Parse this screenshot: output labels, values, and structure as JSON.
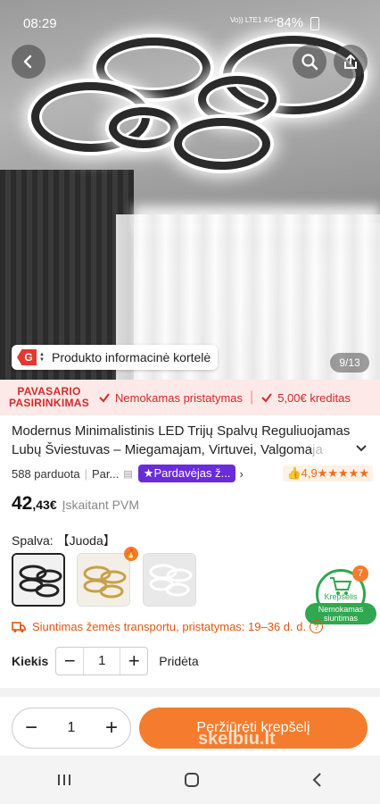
{
  "status_bar": {
    "time": "08:29",
    "network": "Vo))\nLTE1",
    "network_2": "4G+",
    "battery": "84%"
  },
  "gallery": {
    "counter": "9/13",
    "info_badge_letter": "G",
    "info_label": "Produkto informacinė kortelė"
  },
  "promo_bar": {
    "brand_line1": "PAVASARIO",
    "brand_line2": "PASIRINKIMAS",
    "free_shipping": "Nemokamas pristatymas",
    "credit": "5,00€ kreditas"
  },
  "product": {
    "title": "Modernus Minimalistinis LED Trijų Spalvų Reguliuojamas Lubų Šviestuvas – Miegamajam, Virtuvei, Valgomajam",
    "title_visible": "Modernus Minimalistinis LED Trijų Spalvų Reguliuojamas Lubų Šviestuvas – Miegamajam, Virtuvei, Valgoma",
    "title_fade": "ja",
    "sold": "588 parduota",
    "seller_short": "Par...",
    "seller_badge": "Pardavėjas ž...",
    "rating": "4,9",
    "stars": "★★★★★",
    "price_int": "42",
    "price_dec": ",43€",
    "vat": "Įskaitant PVM",
    "color_label": "Spalva:",
    "color_value": "【Juoda】",
    "shipping": "Siuntimas žemės transportu, pristatymas: 19–36 d. d.",
    "qty_label": "Kiekis",
    "qty_value": "1",
    "added_label": "Pridėta"
  },
  "cart_float": {
    "count": "7",
    "label": "Krepšelis",
    "badge_line1": "Nemokamas",
    "badge_line2": "siuntimas"
  },
  "bottom": {
    "qty": "1",
    "cart_button": "Peržiūrėti krepšelį",
    "watermark": "skelbiu.lt"
  },
  "colors": {
    "accent": "#f47c2c",
    "promo": "#d32a2a",
    "seller": "#6a2bd9",
    "shipping": "#e1560e",
    "cart_green": "#2fa84f"
  }
}
